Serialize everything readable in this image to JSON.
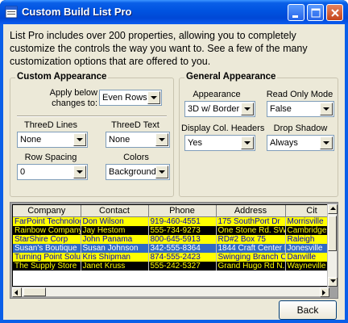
{
  "window": {
    "title": "Custom Build List Pro"
  },
  "intro_text": "List Pro includes over 200 properties, allowing you to completely customize the controls the way you want to. See a few of the many customization options that are offered to you.",
  "custom_appearance": {
    "title": "Custom Appearance",
    "apply_label": "Apply below changes to:",
    "apply_value": "Even Rows",
    "threed_lines_label": "ThreeD Lines",
    "threed_lines_value": "None",
    "threed_text_label": "ThreeD Text",
    "threed_text_value": "None",
    "row_spacing_label": "Row Spacing",
    "row_spacing_value": "0",
    "colors_label": "Colors",
    "colors_value": "Background"
  },
  "general_appearance": {
    "title": "General Appearance",
    "appearance_label": "Appearance",
    "appearance_value": "3D w/ Border",
    "read_only_label": "Read Only Mode",
    "read_only_value": "False",
    "display_headers_label": "Display Col. Headers",
    "display_headers_value": "Yes",
    "drop_shadow_label": "Drop Shadow",
    "drop_shadow_value": "Always"
  },
  "list": {
    "columns": [
      "Company",
      "Contact",
      "Phone",
      "Address",
      "Cit"
    ],
    "rows": [
      {
        "style": "yellow",
        "cells": [
          "FarPoint Technolog",
          "Don Wilson",
          "919-460-4551",
          "175 SouthPort Dr",
          "Morrisville"
        ]
      },
      {
        "style": "black",
        "cells": [
          "Rainbow Company",
          "Jay Hestom",
          "555-734-9273",
          "One Stone Rd. SW",
          "Cambridge"
        ]
      },
      {
        "style": "yellow",
        "cells": [
          "StarShire Corp",
          "John Panama",
          "800-645-5913",
          "RD#2 Box 75",
          "Raleigh"
        ]
      },
      {
        "style": "blue",
        "cells": [
          "Susan's Boutique",
          "Susan Johnson",
          "342-555-8364",
          "1844 Craft Center L",
          "Jonesville"
        ]
      },
      {
        "style": "yellow",
        "cells": [
          "Turning Point Soluti",
          "Kris Shipman",
          "874-555-2423",
          "Swinging Branch Ct",
          "Danville"
        ]
      },
      {
        "style": "black",
        "cells": [
          "The Supply Store",
          "Janet Kruss",
          "555-242-5327",
          "Grand Hugo Rd N.",
          "Wayneville"
        ]
      }
    ]
  },
  "buttons": {
    "back": "Back"
  },
  "colors": {
    "titlebar": "#0054e3",
    "face": "#ece9d8",
    "highlight_yellow": "#ffff00",
    "selected_blue": "#316ac5"
  }
}
